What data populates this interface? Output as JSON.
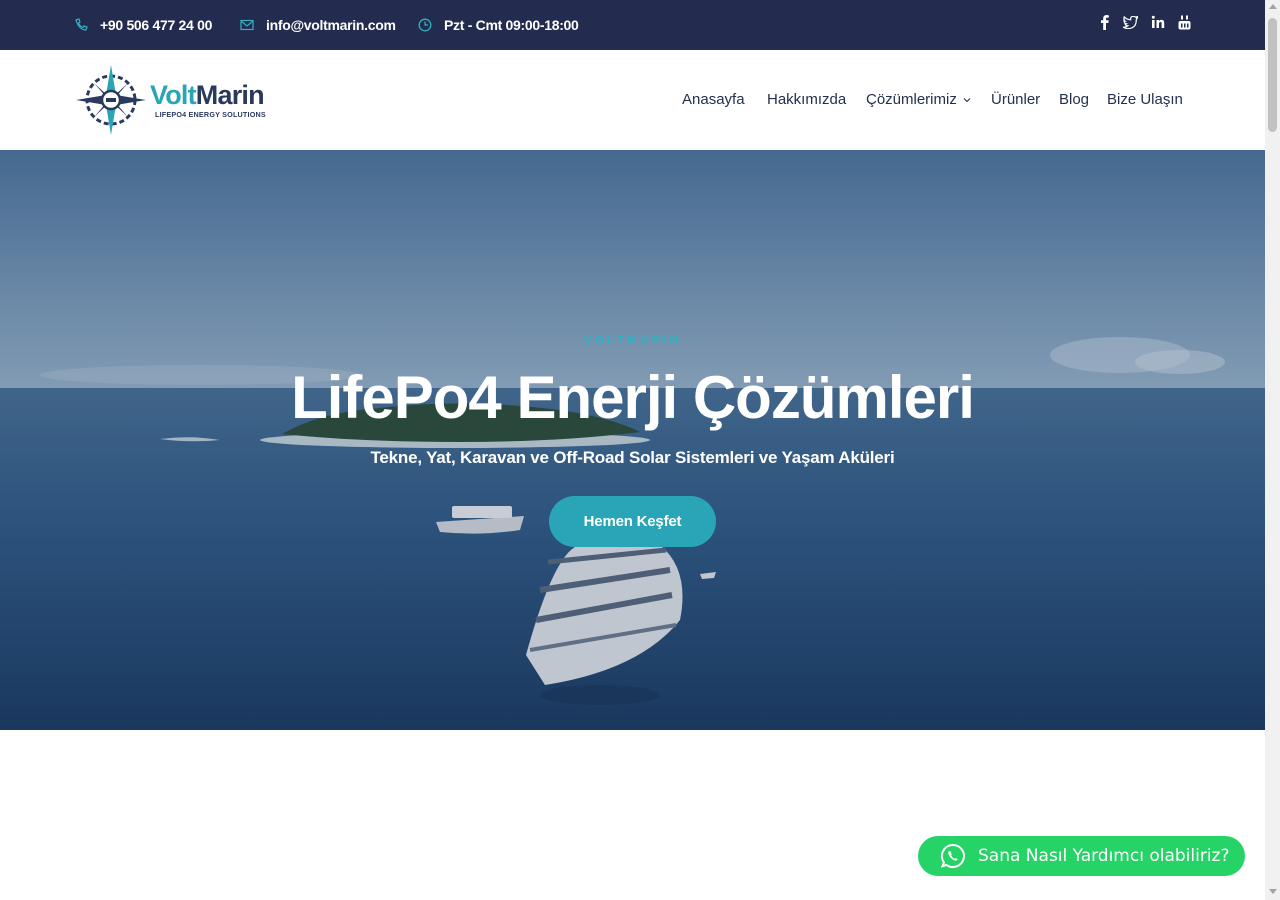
{
  "topbar": {
    "phone": "+90 506 477 24 00",
    "email": "info@voltmarin.com",
    "hours": "Pzt - Cmt 09:00-18:00",
    "social": [
      "facebook-icon",
      "twitter-icon",
      "linkedin-icon",
      "youtube-icon"
    ]
  },
  "logo": {
    "name_part1": "Volt",
    "name_part2": "Marin",
    "tagline": "LIFEPO4 ENERGY SOLUTIONS"
  },
  "nav": {
    "items": [
      "Anasayfa",
      "Hakkımızda",
      "Çözümlerimiz",
      "Ürünler",
      "Blog",
      "Bize Ulaşın"
    ]
  },
  "hero": {
    "kicker": "VOLTMARIN",
    "title": "LifePo4 Enerji Çözümleri",
    "subtitle": "Tekne, Yat, Karavan ve Off-Road Solar Sistemleri ve Yaşam Aküleri",
    "cta": "Hemen Keşfet"
  },
  "whatsapp": {
    "label": "Sana Nasıl Yardımcı olabiliriz?"
  },
  "colors": {
    "topbar_bg": "#232c4e",
    "accent": "#2aa5b7",
    "nav_text": "#23304f",
    "whatsapp": "#25d366"
  }
}
